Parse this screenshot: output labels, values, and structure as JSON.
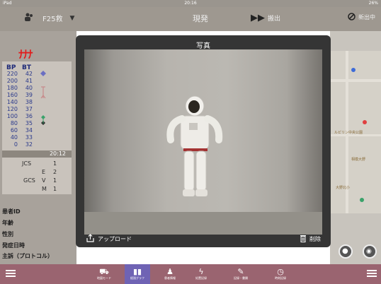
{
  "status_bar": {
    "carrier": "iPad",
    "time": "20:16",
    "battery": "26%"
  },
  "top_bar": {
    "team_label": "F25救",
    "site_label": "現発",
    "transfer_label": "搬出",
    "block_label": "新出中"
  },
  "alert_symbol": "ﾅﾅﾅ",
  "vitals": {
    "bp_header": "BP",
    "bt_header": "BT",
    "rows": [
      {
        "bp": "220",
        "bt": "42"
      },
      {
        "bp": "200",
        "bt": "41"
      },
      {
        "bp": "180",
        "bt": "40"
      },
      {
        "bp": "160",
        "bt": "39"
      },
      {
        "bp": "140",
        "bt": "38"
      },
      {
        "bp": "120",
        "bt": "37"
      },
      {
        "bp": "100",
        "bt": "36"
      },
      {
        "bp": "80",
        "bt": "35"
      },
      {
        "bp": "60",
        "bt": "34"
      },
      {
        "bp": "40",
        "bt": "33"
      },
      {
        "bp": "0",
        "bt": "32"
      }
    ],
    "time": "20:12",
    "jcs_label": "JCS",
    "jcs_value": "1",
    "gcs_label": "GCS",
    "gcs_e_label": "E",
    "gcs_e_value": "2",
    "gcs_v_label": "V",
    "gcs_v_value": "1",
    "gcs_m_label": "M",
    "gcs_m_value": "1"
  },
  "patient_info": {
    "id_label": "患者ID",
    "age_label": "年齢",
    "sex_label": "性別",
    "onset_label": "発症日時",
    "complaint_label": "主訴（プロトコル）"
  },
  "map_labels": [
    "ルピリン中央公園",
    "相模大野",
    "大野北小"
  ],
  "modal": {
    "title": "写真",
    "upload_label": "アップロード",
    "delete_label": "削除"
  },
  "bottom_nav": {
    "items": [
      "地図モード",
      "経過グラフ",
      "患者情報",
      "処置記録",
      "記録・書類",
      "時刻記録"
    ],
    "active_index": 1
  },
  "colors": {
    "alert": "#e21b1b",
    "active_tab": "#6f63b4",
    "nav_bar": "#9a6470",
    "modal_bg": "#353535"
  }
}
